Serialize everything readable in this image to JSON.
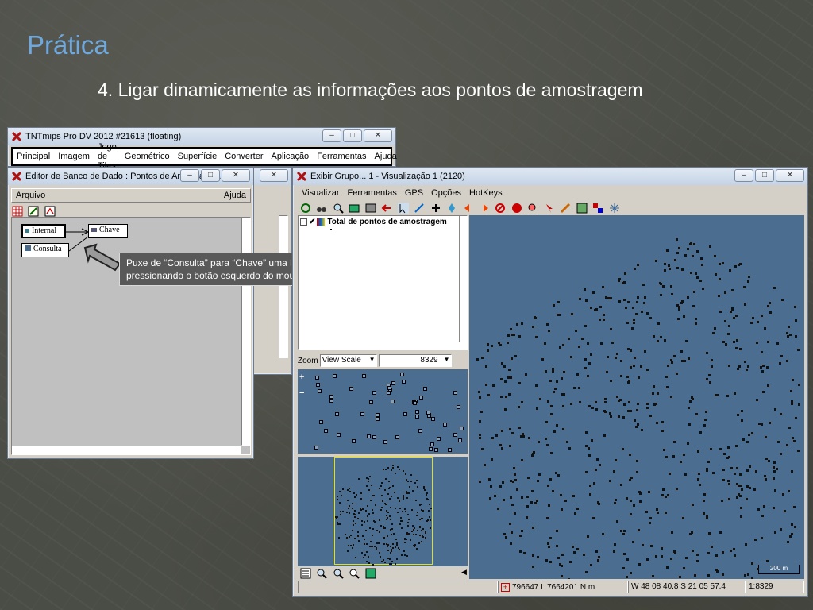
{
  "slide": {
    "title": "Prática",
    "subtitle": "4. Ligar dinamicamente as informações aos pontos de amostragem"
  },
  "main_window": {
    "title": "TNTmips Pro DV 2012  #21613 (floating)",
    "menu": [
      "Principal",
      "Imagem",
      "Jogo de Tiles",
      "Geométrico",
      "Superfície",
      "Converter",
      "Aplicação",
      "Ferramentas",
      "Ajuda"
    ]
  },
  "db_editor": {
    "title": "Editor de Banco de Dado : Pontos de Amostrage...",
    "menu_left": "Arquivo",
    "menu_right": "Ajuda",
    "tables": {
      "internal": "Internal",
      "chave": "Chave",
      "consulta": "Consulta"
    }
  },
  "callout": {
    "text": "Puxe de “Consulta” para “Chave” uma linha, pressionando o botão esquerdo do mouse"
  },
  "view_window": {
    "title": "Exibir Grupo... 1 - Visualização 1 (2120)",
    "menu": [
      "Visualizar",
      "Ferramentas",
      "GPS",
      "Opções",
      "HotKeys"
    ],
    "layer_name": "Total de pontos de amostragem",
    "zoom_label": "Zoom",
    "zoom_mode": "View Scale",
    "zoom_value": "8329",
    "scale_bar": "200 m",
    "status": {
      "coords": "796647 L  7664201 N m",
      "latlon": "W 48 08 40.8  S 21 05 57.4",
      "scale": "1:8329"
    }
  },
  "colors": {
    "title_blue": "#6fa8dc",
    "map_blue": "#4b6d8f",
    "window_gray": "#d4d0c8"
  }
}
